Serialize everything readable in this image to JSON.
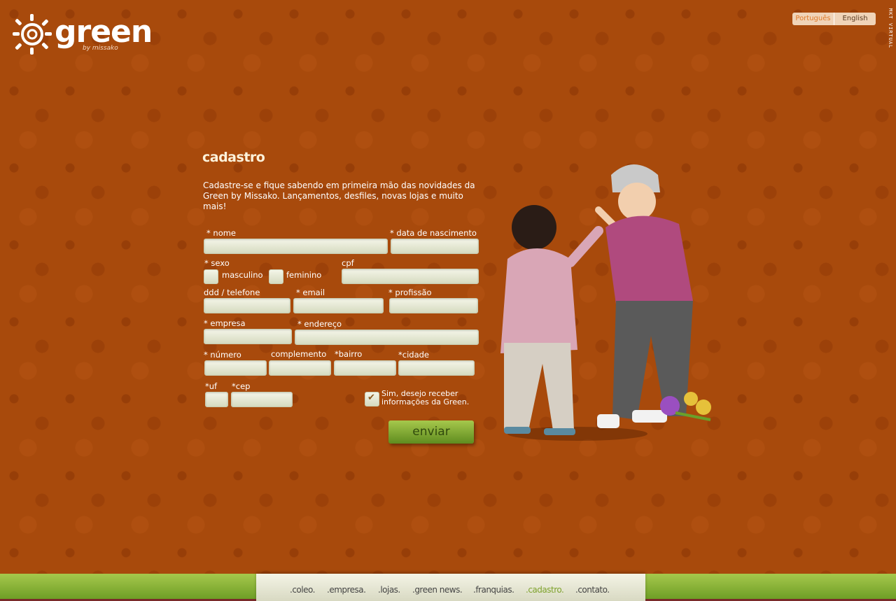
{
  "header": {
    "logo_word": "green",
    "logo_by": "by missako",
    "lang": [
      "Português",
      "English"
    ],
    "vertical_credit": "MKT VIRTUAL"
  },
  "form": {
    "title": "cadastro",
    "intro": "Cadastre-se e fique sabendo em primeira mão das novidades da Green by Missako. Lançamentos, desfiles, novas lojas e muito mais!",
    "labels": {
      "nome": "* nome",
      "nascimento": "* data de nascimento",
      "sexo": "* sexo",
      "masculino": "masculino",
      "feminino": "feminino",
      "cpf": "cpf",
      "telefone": "ddd / telefone",
      "email": "* email",
      "profissao": "* profissão",
      "empresa": "* empresa",
      "endereco": "* endereço",
      "numero": "* número",
      "complemento": "complemento",
      "bairro": "*bairro",
      "cidade": "*cidade",
      "uf": "*uf",
      "cep": "*cep"
    },
    "newsletter": {
      "line1": "Sim, desejo receber",
      "line2": "informações da Green.",
      "checked": true
    },
    "submit": "enviar"
  },
  "nav": {
    "items": [
      ".coleo.",
      ".empresa.",
      ".lojas.",
      ".green news.",
      ".franquias.",
      ".cadastro.",
      ".contato."
    ],
    "active": ".cadastro."
  },
  "colors": {
    "background": "#a84a0c",
    "accent_green": "#8bb33a",
    "language_active": "#e07a28"
  }
}
